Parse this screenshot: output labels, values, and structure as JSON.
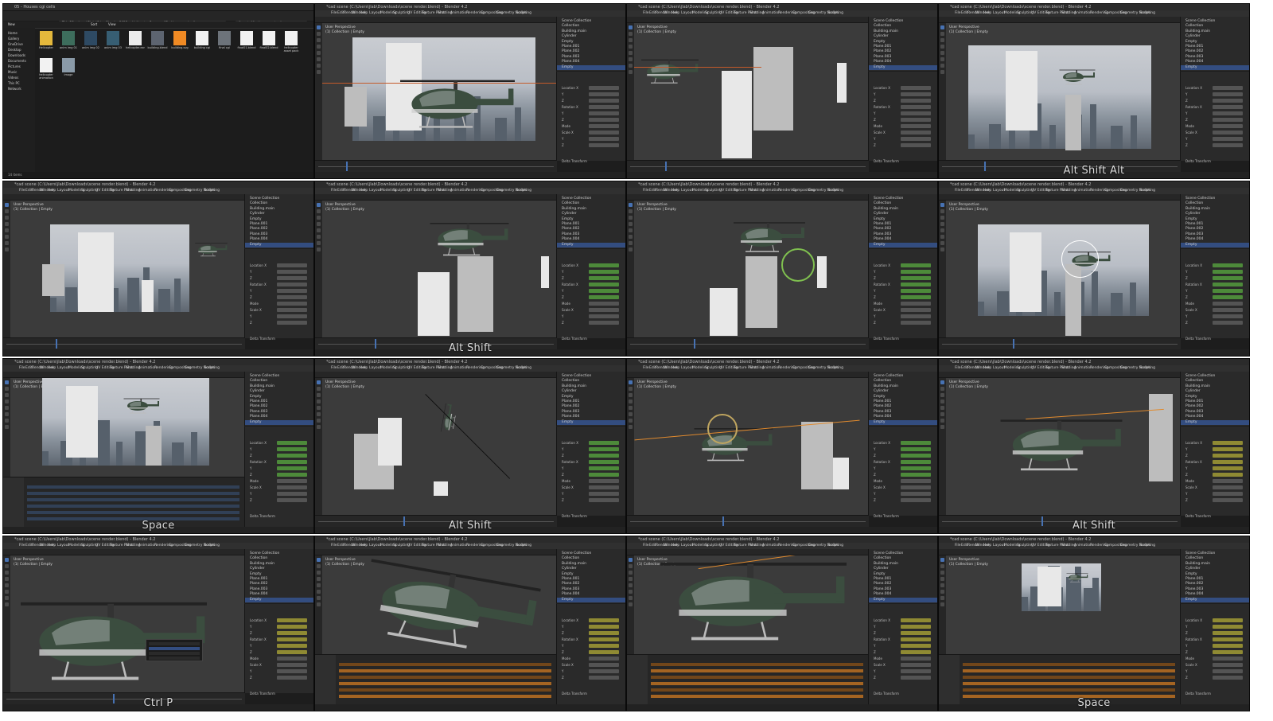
{
  "explorer": {
    "window_title": "05 - Houses cgi cells",
    "address": "This PC > Local Disk (C:) > Blender 2025 > Helicopter Scene > 05 - Houses cgi cells",
    "search_placeholder": "Search 05 - Houses cgi cells",
    "toolbar_new": "New",
    "toolbar_sort": "Sort",
    "toolbar_view": "View",
    "sidebar": [
      "Home",
      "Gallery",
      "OneDrive",
      "Desktop",
      "Downloads",
      "Documents",
      "Pictures",
      "Music",
      "Videos",
      "This PC",
      "Network"
    ],
    "files": [
      {
        "name": "Helicopter",
        "color": "#e4b83c"
      },
      {
        "name": "anim img 01",
        "color": "#3d6d5c"
      },
      {
        "name": "anim img 02",
        "color": "#2e4a63"
      },
      {
        "name": "anim img 03",
        "color": "#375e73"
      },
      {
        "name": "helicopter.exr",
        "color": "#ececec"
      },
      {
        "name": "building.blend",
        "color": "#5d6470"
      },
      {
        "name": "building.svg",
        "color": "#f08a24"
      },
      {
        "name": "building cgi",
        "color": "#f2f2f2"
      },
      {
        "name": "final cgi",
        "color": "#6d737a"
      },
      {
        "name": "final01.blend",
        "color": "#f2f2f2"
      },
      {
        "name": "final02.blend",
        "color": "#f2f2f2"
      },
      {
        "name": "helicopter asset pack",
        "color": "#f2f2f2"
      },
      {
        "name": "helicopter animation",
        "color": "#f2f2f2"
      },
      {
        "name": "image",
        "color": "#8a9aa8"
      }
    ],
    "status": "14 items"
  },
  "blender": {
    "title": "*cad scene (C:\\Users\\jlab\\Downloads\\scene render.blend) - Blender 4.2",
    "menus": [
      "File",
      "Edit",
      "Render",
      "Window",
      "Help",
      "Layout",
      "Modeling",
      "Sculpting",
      "UV Editing",
      "Texture Paint",
      "Shading",
      "Animation",
      "Rendering",
      "Compositing",
      "Geometry Nodes",
      "Scripting"
    ],
    "viewport_label": "User Perspective\n(1) Collection | Empty",
    "outliner": [
      "Scene Collection",
      "Collection",
      "Building.main",
      "Cylinder",
      "Empty",
      "Plane.001",
      "Plane.002",
      "Plane.003",
      "Plane.004",
      "Empty"
    ],
    "props": [
      "Location X",
      "Y",
      "Z",
      "Rotation X",
      "Y",
      "Z",
      "Mode",
      "Scale X",
      "Y",
      "Z"
    ],
    "mode_value": "Quaternion (WXYZ)",
    "status": "Delta Transform"
  },
  "tiles": [
    {
      "id": "explorer",
      "caption": ""
    },
    {
      "id": "t1",
      "caption": ""
    },
    {
      "id": "t2",
      "caption": ""
    },
    {
      "id": "t3",
      "caption": "Alt Shift Alt"
    },
    {
      "id": "t4",
      "caption": ""
    },
    {
      "id": "t5",
      "caption": "Alt Shift"
    },
    {
      "id": "t6",
      "caption": ""
    },
    {
      "id": "t7",
      "caption": ""
    },
    {
      "id": "t8",
      "caption": "Space"
    },
    {
      "id": "t9",
      "caption": "Alt Shift"
    },
    {
      "id": "t10",
      "caption": ""
    },
    {
      "id": "t11",
      "caption": "Alt Shift"
    },
    {
      "id": "t12",
      "caption": "Ctrl P"
    },
    {
      "id": "t13",
      "caption": ""
    },
    {
      "id": "t14",
      "caption": ""
    },
    {
      "id": "t15",
      "caption": "Space"
    }
  ],
  "colors": {
    "blender_bg": "#3b3b3b",
    "panel": "#2a2a2a",
    "select_blue": "#4772b3",
    "keyed_green": "#4d8a3a",
    "keyed_yellow": "#8f8a33",
    "helicopter": "#3b4d3f",
    "orange_path": "#e08a2e"
  }
}
